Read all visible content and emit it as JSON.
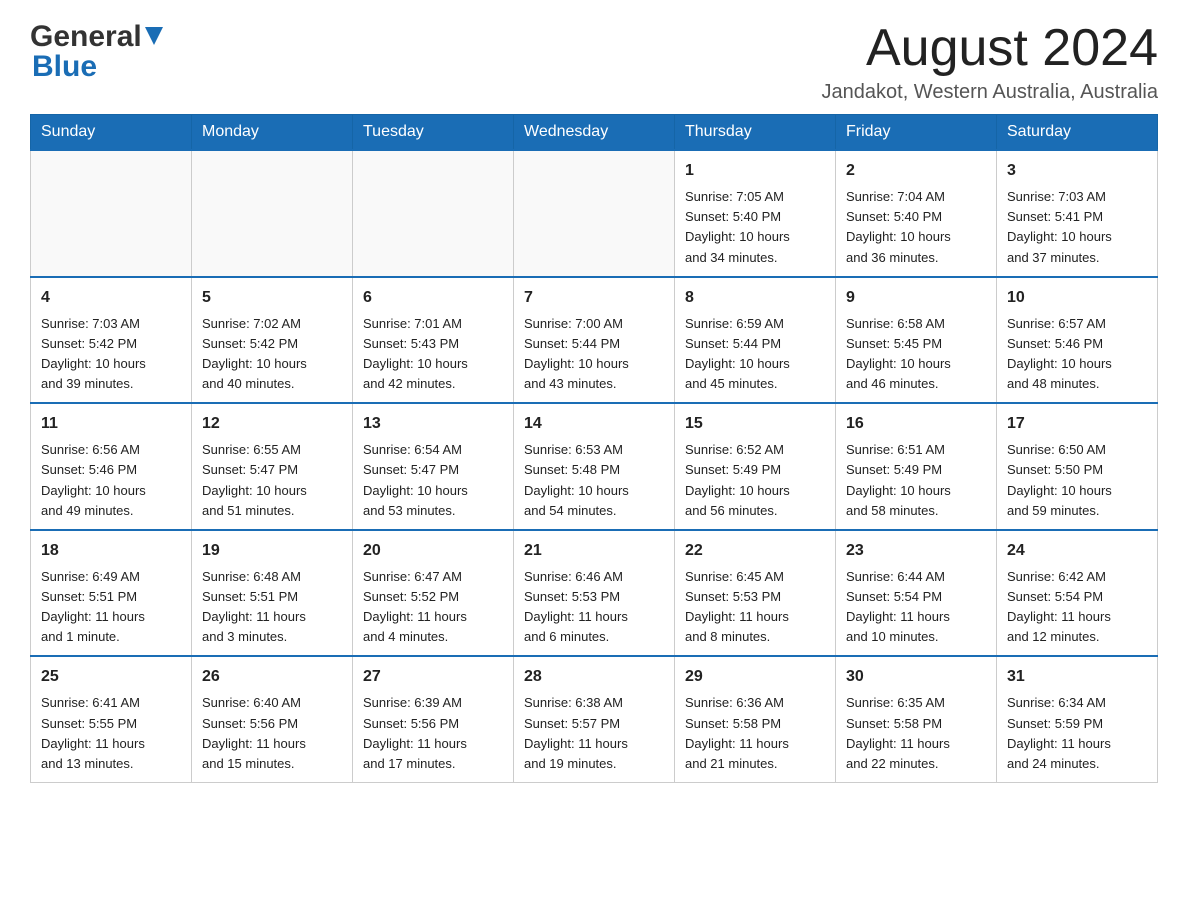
{
  "logo": {
    "general": "General",
    "blue": "Blue"
  },
  "header": {
    "month_year": "August 2024",
    "location": "Jandakot, Western Australia, Australia"
  },
  "days_of_week": [
    "Sunday",
    "Monday",
    "Tuesday",
    "Wednesday",
    "Thursday",
    "Friday",
    "Saturday"
  ],
  "weeks": [
    [
      {
        "day": "",
        "info": ""
      },
      {
        "day": "",
        "info": ""
      },
      {
        "day": "",
        "info": ""
      },
      {
        "day": "",
        "info": ""
      },
      {
        "day": "1",
        "info": "Sunrise: 7:05 AM\nSunset: 5:40 PM\nDaylight: 10 hours\nand 34 minutes."
      },
      {
        "day": "2",
        "info": "Sunrise: 7:04 AM\nSunset: 5:40 PM\nDaylight: 10 hours\nand 36 minutes."
      },
      {
        "day": "3",
        "info": "Sunrise: 7:03 AM\nSunset: 5:41 PM\nDaylight: 10 hours\nand 37 minutes."
      }
    ],
    [
      {
        "day": "4",
        "info": "Sunrise: 7:03 AM\nSunset: 5:42 PM\nDaylight: 10 hours\nand 39 minutes."
      },
      {
        "day": "5",
        "info": "Sunrise: 7:02 AM\nSunset: 5:42 PM\nDaylight: 10 hours\nand 40 minutes."
      },
      {
        "day": "6",
        "info": "Sunrise: 7:01 AM\nSunset: 5:43 PM\nDaylight: 10 hours\nand 42 minutes."
      },
      {
        "day": "7",
        "info": "Sunrise: 7:00 AM\nSunset: 5:44 PM\nDaylight: 10 hours\nand 43 minutes."
      },
      {
        "day": "8",
        "info": "Sunrise: 6:59 AM\nSunset: 5:44 PM\nDaylight: 10 hours\nand 45 minutes."
      },
      {
        "day": "9",
        "info": "Sunrise: 6:58 AM\nSunset: 5:45 PM\nDaylight: 10 hours\nand 46 minutes."
      },
      {
        "day": "10",
        "info": "Sunrise: 6:57 AM\nSunset: 5:46 PM\nDaylight: 10 hours\nand 48 minutes."
      }
    ],
    [
      {
        "day": "11",
        "info": "Sunrise: 6:56 AM\nSunset: 5:46 PM\nDaylight: 10 hours\nand 49 minutes."
      },
      {
        "day": "12",
        "info": "Sunrise: 6:55 AM\nSunset: 5:47 PM\nDaylight: 10 hours\nand 51 minutes."
      },
      {
        "day": "13",
        "info": "Sunrise: 6:54 AM\nSunset: 5:47 PM\nDaylight: 10 hours\nand 53 minutes."
      },
      {
        "day": "14",
        "info": "Sunrise: 6:53 AM\nSunset: 5:48 PM\nDaylight: 10 hours\nand 54 minutes."
      },
      {
        "day": "15",
        "info": "Sunrise: 6:52 AM\nSunset: 5:49 PM\nDaylight: 10 hours\nand 56 minutes."
      },
      {
        "day": "16",
        "info": "Sunrise: 6:51 AM\nSunset: 5:49 PM\nDaylight: 10 hours\nand 58 minutes."
      },
      {
        "day": "17",
        "info": "Sunrise: 6:50 AM\nSunset: 5:50 PM\nDaylight: 10 hours\nand 59 minutes."
      }
    ],
    [
      {
        "day": "18",
        "info": "Sunrise: 6:49 AM\nSunset: 5:51 PM\nDaylight: 11 hours\nand 1 minute."
      },
      {
        "day": "19",
        "info": "Sunrise: 6:48 AM\nSunset: 5:51 PM\nDaylight: 11 hours\nand 3 minutes."
      },
      {
        "day": "20",
        "info": "Sunrise: 6:47 AM\nSunset: 5:52 PM\nDaylight: 11 hours\nand 4 minutes."
      },
      {
        "day": "21",
        "info": "Sunrise: 6:46 AM\nSunset: 5:53 PM\nDaylight: 11 hours\nand 6 minutes."
      },
      {
        "day": "22",
        "info": "Sunrise: 6:45 AM\nSunset: 5:53 PM\nDaylight: 11 hours\nand 8 minutes."
      },
      {
        "day": "23",
        "info": "Sunrise: 6:44 AM\nSunset: 5:54 PM\nDaylight: 11 hours\nand 10 minutes."
      },
      {
        "day": "24",
        "info": "Sunrise: 6:42 AM\nSunset: 5:54 PM\nDaylight: 11 hours\nand 12 minutes."
      }
    ],
    [
      {
        "day": "25",
        "info": "Sunrise: 6:41 AM\nSunset: 5:55 PM\nDaylight: 11 hours\nand 13 minutes."
      },
      {
        "day": "26",
        "info": "Sunrise: 6:40 AM\nSunset: 5:56 PM\nDaylight: 11 hours\nand 15 minutes."
      },
      {
        "day": "27",
        "info": "Sunrise: 6:39 AM\nSunset: 5:56 PM\nDaylight: 11 hours\nand 17 minutes."
      },
      {
        "day": "28",
        "info": "Sunrise: 6:38 AM\nSunset: 5:57 PM\nDaylight: 11 hours\nand 19 minutes."
      },
      {
        "day": "29",
        "info": "Sunrise: 6:36 AM\nSunset: 5:58 PM\nDaylight: 11 hours\nand 21 minutes."
      },
      {
        "day": "30",
        "info": "Sunrise: 6:35 AM\nSunset: 5:58 PM\nDaylight: 11 hours\nand 22 minutes."
      },
      {
        "day": "31",
        "info": "Sunrise: 6:34 AM\nSunset: 5:59 PM\nDaylight: 11 hours\nand 24 minutes."
      }
    ]
  ]
}
